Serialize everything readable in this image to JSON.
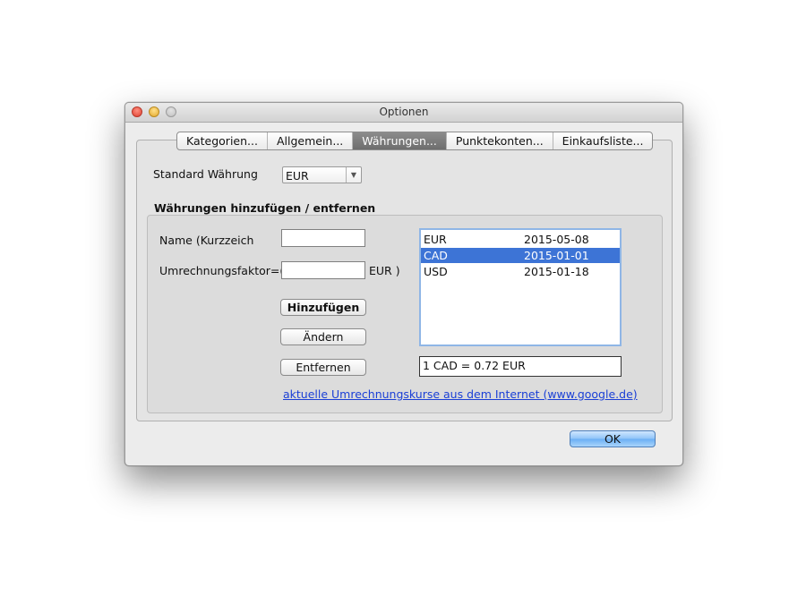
{
  "window": {
    "title": "Optionen"
  },
  "tabs": [
    {
      "label": "Kategorien..."
    },
    {
      "label": "Allgemein..."
    },
    {
      "label": "Währungen..."
    },
    {
      "label": "Punktekonten..."
    },
    {
      "label": "Einkaufsliste..."
    }
  ],
  "selected_tab": "Währungen...",
  "standard": {
    "label": "Standard Währung",
    "value": "EUR"
  },
  "group": {
    "title": "Währungen hinzufügen / entfernen",
    "name_label": "Name (Kurzzeich",
    "name_value": "",
    "factor_label": "Umrechnungsfaktor=(",
    "factor_value": "",
    "factor_unit": "EUR )",
    "add_button": "Hinzufügen",
    "change_button": "Ändern",
    "remove_button": "Entfernen",
    "currencies": [
      {
        "code": "EUR",
        "date": "2015-05-08"
      },
      {
        "code": "CAD",
        "date": "2015-01-01"
      },
      {
        "code": "USD",
        "date": "2015-01-18"
      }
    ],
    "selected_currency": "CAD",
    "conversion_text": "1 CAD = 0.72 EUR",
    "link_text": "aktuelle Umrechnungskurse aus dem Internet (www.google.de)"
  },
  "ok_button": "OK",
  "colors": {
    "selection": "#3d74d6",
    "link": "#1a3fd6",
    "ok_button": "#8ec3f7"
  }
}
